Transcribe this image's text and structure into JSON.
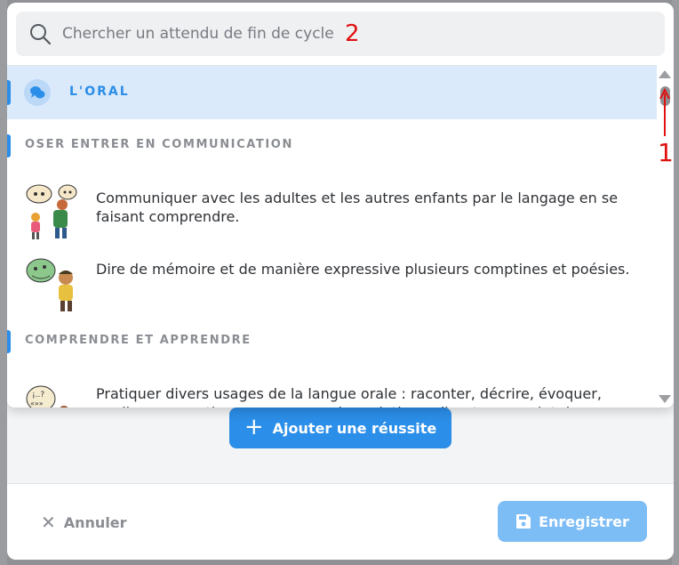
{
  "search": {
    "placeholder": "Chercher un attendu de fin de cycle",
    "annotation": "2"
  },
  "scroll_annotation": "1",
  "group": {
    "label": "L'ORAL",
    "icon": "speech-bubbles-icon"
  },
  "sections": [
    {
      "label": "OSER ENTRER EN COMMUNICATION",
      "items": [
        {
          "text": "Communiquer avec les adultes et les autres enfants par le langage en se faisant comprendre.",
          "icon": "children-talking-illustration"
        },
        {
          "text": "Dire de mémoire et de manière expressive plusieurs comptines et poésies.",
          "icon": "child-reciting-illustration"
        }
      ]
    },
    {
      "label": "COMPRENDRE ET APPRENDRE",
      "items": [
        {
          "text": "Pratiquer divers usages de la langue orale : raconter, décrire, évoquer, expliquer, questionner, proposer des solutions, discuter un point de",
          "icon": "child-speaking-illustration"
        }
      ]
    }
  ],
  "buttons": {
    "add": "Ajouter une réussite",
    "cancel": "Annuler",
    "save": "Enregistrer"
  },
  "colors": {
    "accent": "#2b8ee8",
    "accent_light": "#dbeafb",
    "save_disabled": "#7dbdf5",
    "annotation": "#e01010"
  }
}
